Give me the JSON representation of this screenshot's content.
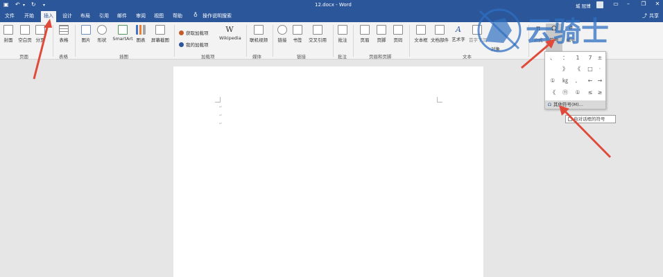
{
  "window": {
    "title": "12.docx - Word",
    "user": "城 冠博",
    "share": "共享"
  },
  "tabs": [
    "文件",
    "开始",
    "插入",
    "设计",
    "布局",
    "引用",
    "邮件",
    "审阅",
    "视图",
    "帮助"
  ],
  "tell_me": "操作说明搜索",
  "ribbon": {
    "pages": {
      "cover": "封面",
      "blank": "空白页",
      "break": "分页",
      "group": "页面"
    },
    "table": {
      "label": "表格",
      "group": "表格"
    },
    "illustrations": {
      "pictures": "图片",
      "shapes": "形状",
      "smartart": "SmartArt",
      "chart": "图表",
      "screenshot": "屏幕截图",
      "group": "插图"
    },
    "addins": {
      "get": "获取加载项",
      "mine": "我的加载项",
      "wikipedia": "Wikipedia",
      "group": "加载项"
    },
    "media": {
      "video": "联机视频",
      "group": "媒体"
    },
    "links": {
      "link": "链接",
      "bookmark": "书签",
      "crossref": "交叉引用",
      "group": "链接"
    },
    "comments": {
      "comment": "批注",
      "group": "批注"
    },
    "header_footer": {
      "header": "页眉",
      "footer": "页脚",
      "page_number": "页码",
      "group": "页眉和页脚"
    },
    "text": {
      "textbox": "文本框",
      "quickparts": "文档部件",
      "wordart": "艺术字",
      "dropcap": "首字下沉",
      "object": "对象",
      "group": "文本"
    },
    "symbols": {
      "equation": "公式",
      "symbol": "符号",
      "number": "编号"
    }
  },
  "symbol_dropdown": {
    "symbols": [
      [
        "、",
        "：",
        "1",
        "7",
        "±"
      ],
      [
        "",
        "》",
        "《",
        "□",
        "·"
      ],
      [
        "①",
        "㎏",
        "．",
        "←",
        "→"
      ],
      [
        "《",
        "⑪",
        "①",
        "≤",
        "≥"
      ]
    ],
    "more": "其他符号(M)...",
    "tooltip": "自对话框的符号"
  },
  "watermark": {
    "text": "云骑士"
  },
  "colors": {
    "brand": "#2b579a",
    "arrow": "#e04a3a"
  }
}
